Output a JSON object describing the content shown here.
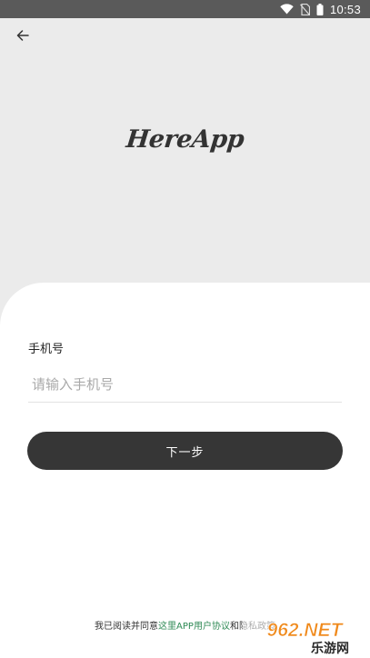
{
  "status_bar": {
    "time": "10:53",
    "icons": [
      "wifi-icon",
      "no-sim-icon",
      "battery-icon"
    ]
  },
  "header": {
    "back_icon": "arrow-left-icon"
  },
  "logo": {
    "text": "HereApp"
  },
  "form": {
    "phone_label": "手机号",
    "phone_placeholder": "请输入手机号",
    "phone_value": "",
    "next_button_label": "下一步"
  },
  "footer": {
    "agreement_prefix": "我已阅读并同意",
    "agreement_link": "这里APP用户协议",
    "agreement_suffix": "和隐私政策"
  },
  "watermark": {
    "top": "962.NET",
    "bottom": "乐游网"
  },
  "colors": {
    "status_bar": "#5a5a5a",
    "header_bg": "#ebebeb",
    "sheet_bg": "#ffffff",
    "button_bg": "#363636",
    "link": "#2f8a55",
    "watermark_orange": "#f08a1c"
  }
}
